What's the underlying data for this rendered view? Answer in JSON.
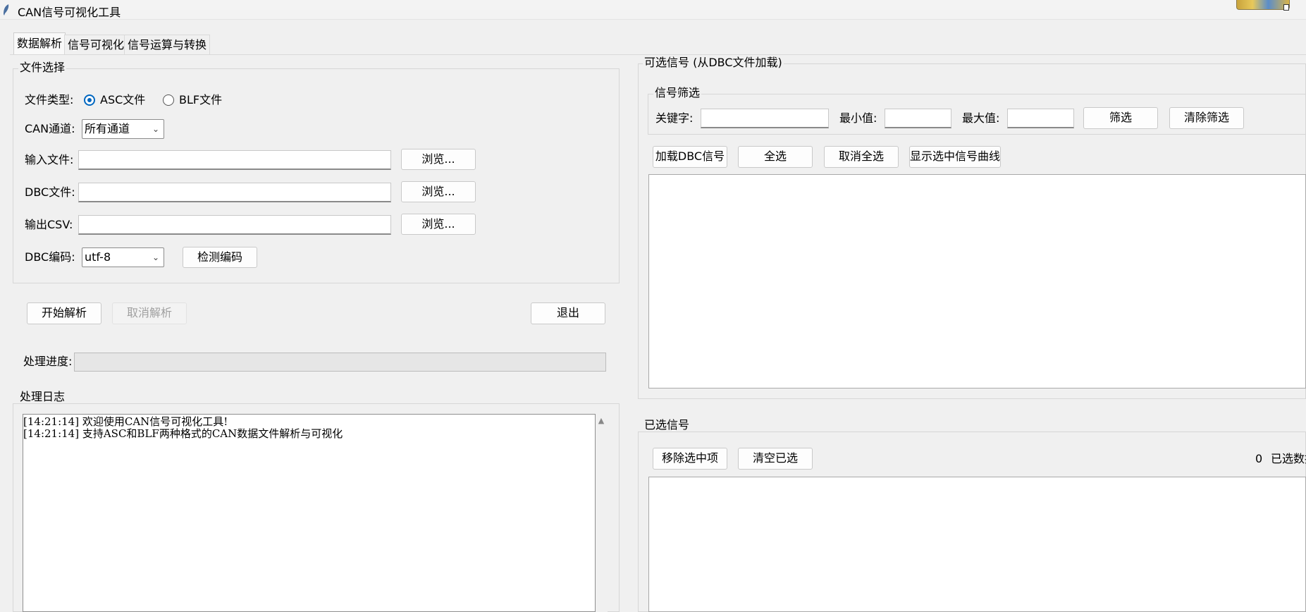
{
  "window": {
    "title": "CAN信号可视化工具"
  },
  "tabs": [
    "数据解析",
    "信号可视化",
    "信号运算与转换"
  ],
  "file_select": {
    "title": "文件选择",
    "file_type_label": "文件类型:",
    "radio_asc": "ASC文件",
    "radio_blf": "BLF文件",
    "selected_type": "ASC文件",
    "can_channel_label": "CAN通道:",
    "can_channel_value": "所有通道",
    "input_file_label": "输入文件:",
    "input_file_value": "",
    "dbc_file_label": "DBC文件:",
    "dbc_file_value": "",
    "output_csv_label": "输出CSV:",
    "output_csv_value": "",
    "browse_label": "浏览...",
    "dbc_encoding_label": "DBC编码:",
    "dbc_encoding_value": "utf-8",
    "detect_encoding_label": "检测编码"
  },
  "actions": {
    "start_parse": "开始解析",
    "cancel_parse": "取消解析",
    "exit": "退出"
  },
  "progress": {
    "label": "处理进度:",
    "value": 0
  },
  "log": {
    "title": "处理日志",
    "lines": [
      "[14:21:14] 欢迎使用CAN信号可视化工具!",
      "[14:21:14] 支持ASC和BLF两种格式的CAN数据文件解析与可视化"
    ]
  },
  "available_signals": {
    "title": "可选信号 (从DBC文件加载)",
    "filter": {
      "title": "信号筛选",
      "keyword_label": "关键字:",
      "keyword_value": "",
      "min_label": "最小值:",
      "min_value": "",
      "max_label": "最大值:",
      "max_value": "",
      "filter_button": "筛选",
      "clear_filter_button": "清除筛选"
    },
    "load_dbc_button": "加载DBC信号",
    "select_all_button": "全选",
    "deselect_all_button": "取消全选",
    "show_curves_button": "显示选中信号曲线"
  },
  "selected_signals": {
    "title": "已选信号",
    "remove_selected_button": "移除选中项",
    "clear_selected_button": "清空已选",
    "count": "0",
    "count_label": "已选数据"
  }
}
